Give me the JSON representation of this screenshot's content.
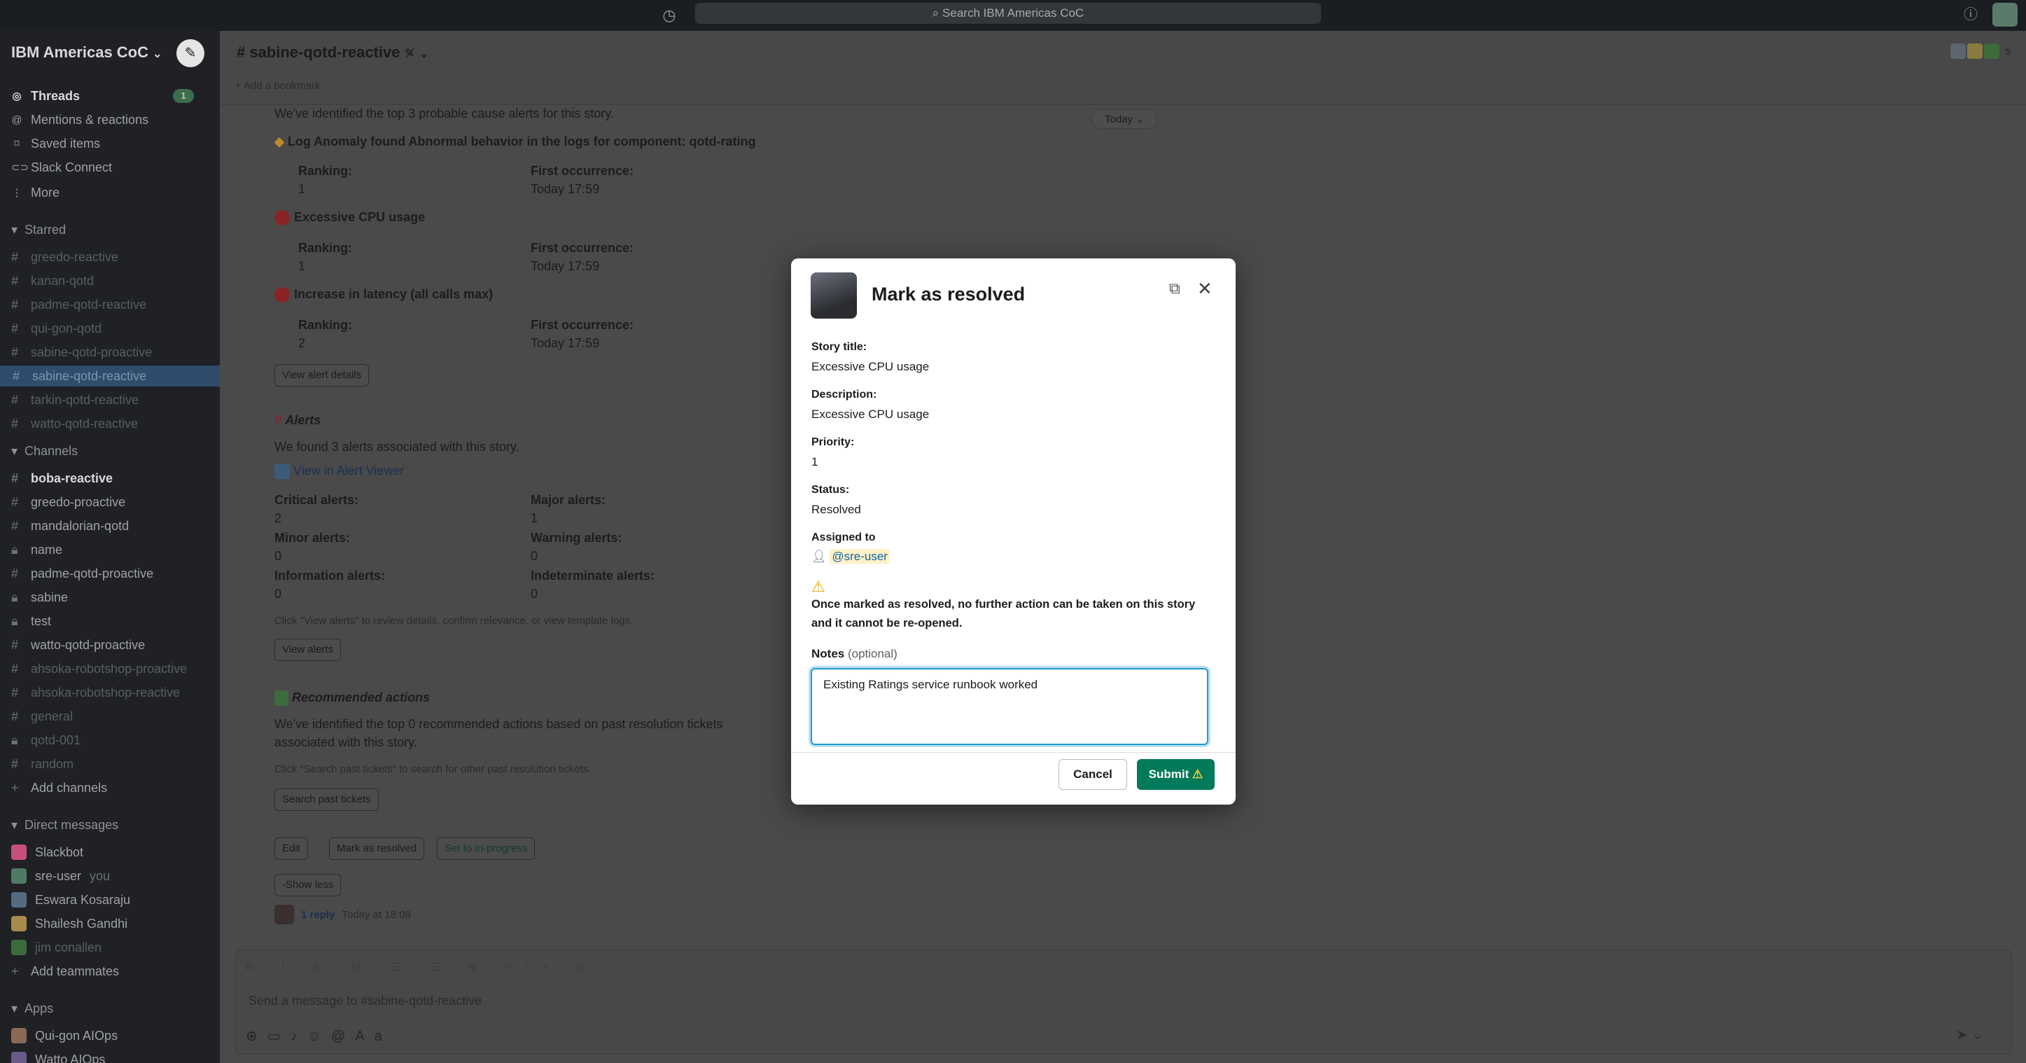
{
  "topbar": {
    "search_placeholder": "Search IBM Americas CoC",
    "history_icon": "clock-icon",
    "help_icon": "?"
  },
  "sidebar": {
    "workspace": "IBM Americas CoC",
    "workspace_chevron": "⌄",
    "nav": [
      {
        "label": "Threads",
        "badge": "1"
      },
      {
        "label": "Mentions & reactions"
      },
      {
        "label": "Saved items"
      },
      {
        "label": "Slack Connect"
      },
      {
        "label": "More"
      }
    ],
    "starred_label": "Starred",
    "starred": [
      "greedo-reactive",
      "kanan-qotd",
      "padme-qotd-reactive",
      "qui-gon-qotd",
      "sabine-qotd-proactive",
      "sabine-qotd-reactive",
      "tarkin-qotd-reactive",
      "watto-qotd-reactive"
    ],
    "channels_label": "Channels",
    "channels": [
      "boba-reactive",
      "greedo-proactive",
      "mandalorian-qotd",
      "name",
      "padme-qotd-proactive",
      "sabine",
      "test",
      "watto-qotd-proactive",
      "ahsoka-robotshop-proactive",
      "ahsoka-robotshop-reactive",
      "general",
      "qotd-001",
      "random"
    ],
    "add_channels": "Add channels",
    "dm_label": "Direct messages",
    "dms": [
      "Slackbot",
      "sre-user",
      "Eswara Kosaraju",
      "Shailesh Gandhi",
      "jim conallen"
    ],
    "dm_you": "you",
    "add_teammates": "Add teammates",
    "apps_label": "Apps",
    "apps": [
      "Qui-gon AIOps",
      "Watto AIOps"
    ]
  },
  "channel": {
    "name": "# sabine-qotd-reactive",
    "add_bookmark": "Add a bookmark",
    "member_count": "5",
    "date_divider": "Today"
  },
  "message": {
    "intro": "We've identified the top 3 probable cause alerts for this story.",
    "log_anomaly": "Log Anomaly found Abnormal behavior in the logs for component: qotd-rating",
    "items": [
      {
        "ranking_label": "Ranking:",
        "ranking": "1",
        "first_label": "First occurrence:",
        "first": "Today 17:59"
      },
      {
        "title": "Excessive CPU usage",
        "ranking_label": "Ranking:",
        "ranking": "1",
        "first_label": "First occurrence:",
        "first": "Today 17:59"
      },
      {
        "title": "Increase in latency (all calls max)",
        "ranking_label": "Ranking:",
        "ranking": "2",
        "first_label": "First occurrence:",
        "first": "Today 17:59"
      }
    ],
    "view_alert_details": "View alert details",
    "alerts_title": "Alerts",
    "alerts_found": "We found 3 alerts associated with this story.",
    "view_in_alert_viewer": "View in Alert Viewer",
    "critical_label": "Critical alerts:",
    "critical": "2",
    "major_label": "Major alerts:",
    "major": "1",
    "minor_label": "Minor alerts:",
    "minor": "0",
    "warning_label": "Warning alerts:",
    "warning": "0",
    "info_label": "Information alerts:",
    "info": "0",
    "indeterminate_label": "Indeterminate alerts:",
    "indeterminate": "0",
    "view_alerts_hint": "Click \"View alerts\" to review details, confirm relevance, or view template logs.",
    "view_alerts": "View alerts",
    "recommended_title": "Recommended actions",
    "recommended_text_1": "We've identified the top 0 recommended actions based on past resolution tickets",
    "recommended_text_2": "associated with this story.",
    "search_hint": "Click \"Search past tickets\" to search for other past resolution tickets.",
    "search_past": "Search past tickets",
    "edit": "Edit",
    "mark_resolved": "Mark as resolved",
    "set_in_progress": "Set to in-progress",
    "show_less": "Show less",
    "reply_count": "1 reply",
    "reply_time": "Today at 18:08"
  },
  "composer": {
    "placeholder": "Send a message to #sabine-qotd-reactive"
  },
  "modal": {
    "title": "Mark as resolved",
    "story_title_label": "Story title:",
    "story_title": "Excessive CPU usage",
    "description_label": "Description:",
    "description": "Excessive CPU usage",
    "priority_label": "Priority:",
    "priority": "1",
    "status_label": "Status:",
    "status": "Resolved",
    "assigned_label": "Assigned to",
    "assigned": "@sre-user",
    "warning_line1": "Once marked as resolved, no further action can be taken on this story",
    "warning_line2": "and it cannot be re-opened.",
    "notes_label": "Notes",
    "notes_optional": "(optional)",
    "notes_value": "Existing Ratings service runbook worked",
    "cancel": "Cancel",
    "submit": "Submit"
  },
  "colors": {
    "submit_green": "#007a5a",
    "focus_blue": "#1d9bd1",
    "sidebar_active": "#2f4c6c"
  }
}
